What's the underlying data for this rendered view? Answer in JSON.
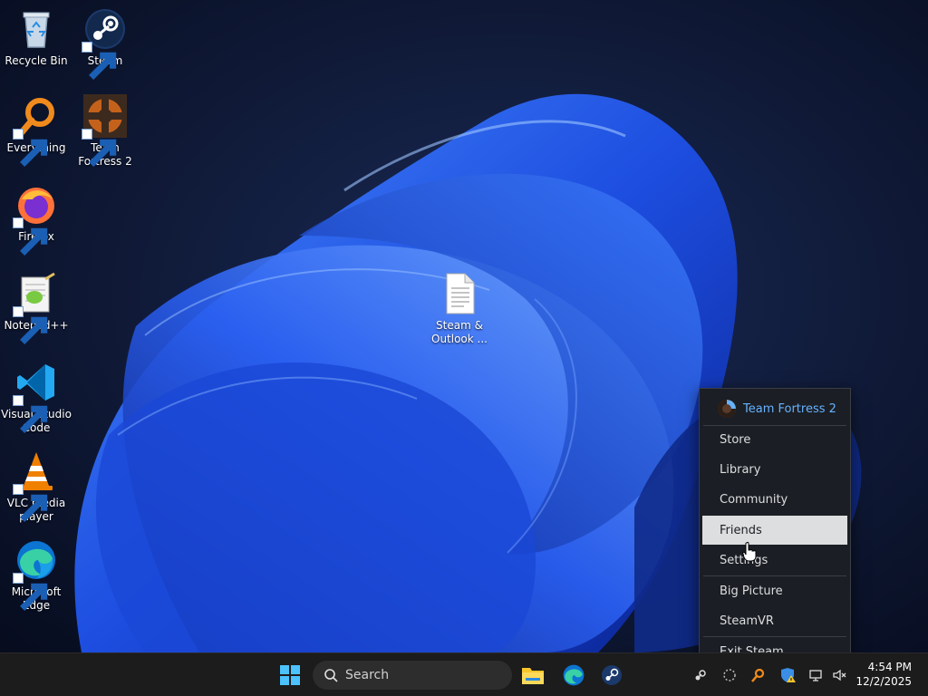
{
  "desktop": {
    "icons": [
      {
        "label": "Recycle Bin",
        "icon": "recycle-bin-icon",
        "shortcut": false
      },
      {
        "label": "Steam",
        "icon": "steam-icon",
        "shortcut": true
      },
      {
        "label": "Everything",
        "icon": "everything-icon",
        "shortcut": true
      },
      {
        "label": "Team Fortress 2",
        "icon": "team-fortress-2-icon",
        "shortcut": true
      },
      {
        "label": "Firefox",
        "icon": "firefox-icon",
        "shortcut": true
      },
      {
        "label": "Notepad++",
        "icon": "notepad-plus-plus-icon",
        "shortcut": true
      },
      {
        "label": "Visual Studio Code",
        "icon": "vscode-icon",
        "shortcut": true
      },
      {
        "label": "VLC media player",
        "icon": "vlc-icon",
        "shortcut": true
      },
      {
        "label": "Microsoft Edge",
        "icon": "edge-icon",
        "shortcut": true
      },
      {
        "label": "Steam & Outlook ...",
        "icon": "text-file-icon",
        "shortcut": false
      }
    ]
  },
  "steam_menu": {
    "header": "Team Fortress 2",
    "items": [
      {
        "label": "Store"
      },
      {
        "label": "Library"
      },
      {
        "label": "Community"
      },
      {
        "label": "Friends",
        "hovered": true
      },
      {
        "label": "Settings"
      },
      {
        "label": "Big Picture"
      },
      {
        "label": "SteamVR"
      },
      {
        "label": "Exit Steam"
      }
    ]
  },
  "taskbar": {
    "search_placeholder": "Search",
    "pinned": [
      "start-icon",
      "file-explorer-icon",
      "edge-icon",
      "steam-icon"
    ],
    "tray": [
      "steam-tray-icon",
      "app-tray-icon",
      "everything-tray-icon",
      "security-warning-icon",
      "network-icon",
      "volume-muted-icon"
    ],
    "clock": {
      "time": "4:54 PM",
      "date": "12/2/2025"
    }
  },
  "colors": {
    "taskbar_bg": "#1c1c1c",
    "menu_bg": "#1b1e24",
    "menu_header_text": "#66b2ff",
    "menu_hover_bg": "#dcdedf"
  }
}
